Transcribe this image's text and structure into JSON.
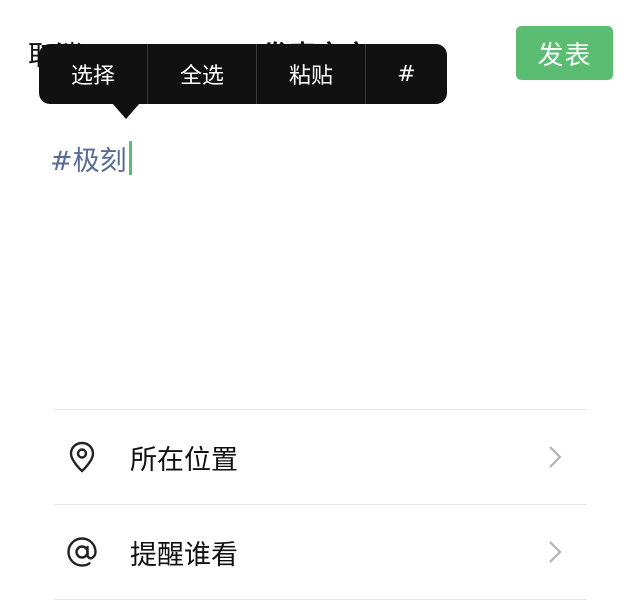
{
  "nav": {
    "cancel_label": "取消",
    "title": "发表文字",
    "post_label": "发表"
  },
  "context_menu": {
    "items": [
      "选择",
      "全选",
      "粘贴",
      "#"
    ]
  },
  "editor": {
    "text": "#极刻"
  },
  "options": [
    {
      "icon": "location-pin-icon",
      "label": "所在位置"
    },
    {
      "icon": "at-sign-icon",
      "label": "提醒谁看"
    }
  ],
  "colors": {
    "accent_green": "#5bbd72",
    "hashtag_blue": "#576b95",
    "menu_bg": "#111111"
  }
}
